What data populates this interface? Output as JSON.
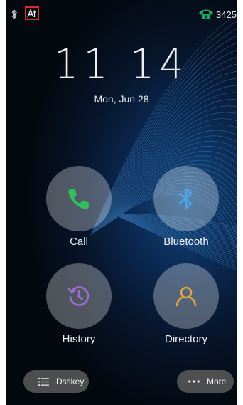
{
  "status_bar": {
    "extension": "3425",
    "icons": [
      "bluetooth-icon",
      "input-method-icon",
      "phone-line-icon"
    ],
    "input_method_highlight_color": "#e52a2a",
    "phone_line_color": "#1fa85b"
  },
  "clock": {
    "time": "11 14",
    "date": "Mon, Jun 28"
  },
  "tiles": [
    {
      "label": "Call",
      "icon": "phone-icon",
      "icon_color": "#2fbf5a"
    },
    {
      "label": "Bluetooth",
      "icon": "bluetooth-icon",
      "icon_color": "#4aa6e8"
    },
    {
      "label": "History",
      "icon": "history-icon",
      "icon_color": "#9b6fd0"
    },
    {
      "label": "Directory",
      "icon": "directory-icon",
      "icon_color": "#e2a640"
    }
  ],
  "bottom": {
    "dsskey_label": "Dsskey",
    "more_label": "More"
  }
}
